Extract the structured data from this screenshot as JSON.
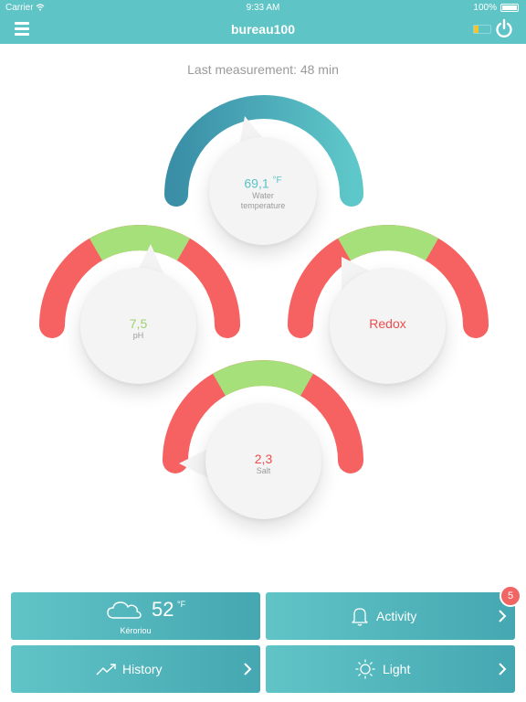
{
  "status_bar": {
    "carrier": "Carrier",
    "time": "9:33 AM",
    "battery": "100%"
  },
  "nav": {
    "title": "bureau100"
  },
  "last_measurement": "Last measurement: 48 min",
  "gauges": {
    "temperature": {
      "value": "69,1",
      "unit": "°F",
      "label_line1": "Water",
      "label_line2": "temperature"
    },
    "ph": {
      "value": "7,5",
      "label": "pH"
    },
    "redox": {
      "value": "Redox"
    },
    "salt": {
      "value": "2,3",
      "label": "Salt"
    }
  },
  "tiles": {
    "weather": {
      "temp": "52",
      "unit": "°F",
      "location": "Kéroriou",
      "icon": "cloud-icon"
    },
    "activity": {
      "label": "Activity",
      "badge": "5",
      "icon": "bell-icon"
    },
    "history": {
      "label": "History",
      "icon": "trend-up-icon"
    },
    "light": {
      "label": "Light",
      "icon": "sun-icon"
    }
  },
  "colors": {
    "primary": "#5ec4c6",
    "gauge_red": "#f66262",
    "gauge_green": "#a6e07a",
    "temp_blue": "#3a94aa",
    "value_green": "#9bd36e",
    "value_red": "#ee4d4d",
    "value_teal": "#5bc2c6",
    "badge_red": "#f26565"
  }
}
